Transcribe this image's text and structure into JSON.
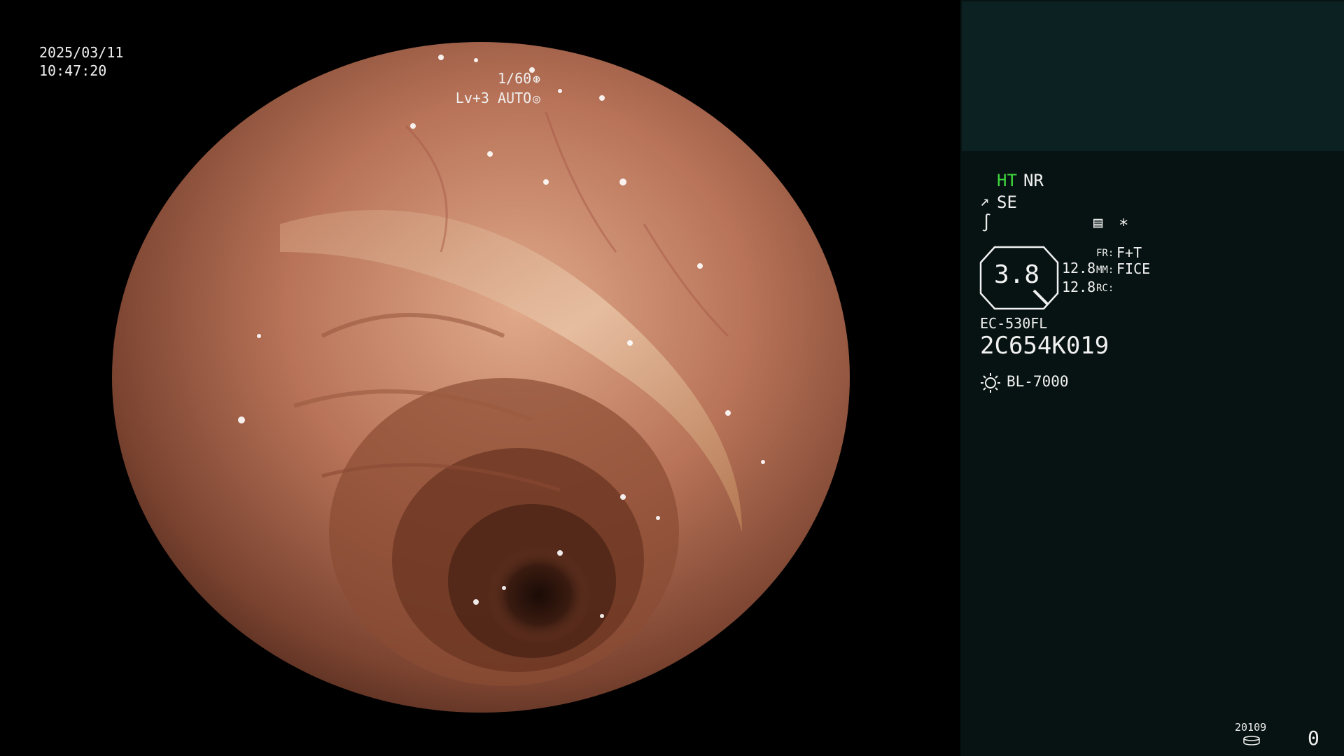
{
  "overlay": {
    "date": "2025/03/11",
    "time": "10:47:20",
    "shutter": "1/60",
    "shutter_icon": "aperture-icon",
    "level": "Lv+3 AUTO",
    "level_icon": "iris-icon"
  },
  "panel": {
    "ht": "HT",
    "nr": "NR",
    "se_icon": "structure-enhance-icon",
    "se": "SE",
    "curve_icon": "tone-curve-icon",
    "doc_icon": "document-icon",
    "star": "*",
    "zoom_value": "3.8",
    "value_1": "12.8",
    "value_2": "12.8",
    "fr_label": "FR:",
    "fr_value": "F+T",
    "mm_label": "MM:",
    "mm_value": "FICE",
    "rc_label": "RC:",
    "scope_model": "EC-530FL",
    "scope_serial": "2C654K019",
    "light_icon": "sun-icon",
    "light_source": "BL-7000",
    "counter_small": "20109",
    "disk_icon": "disk-icon",
    "counter": "0"
  },
  "colors": {
    "ht_green": "#3ed63e",
    "panel_bg": "#071312",
    "thumb_bg": "#0c2222"
  }
}
